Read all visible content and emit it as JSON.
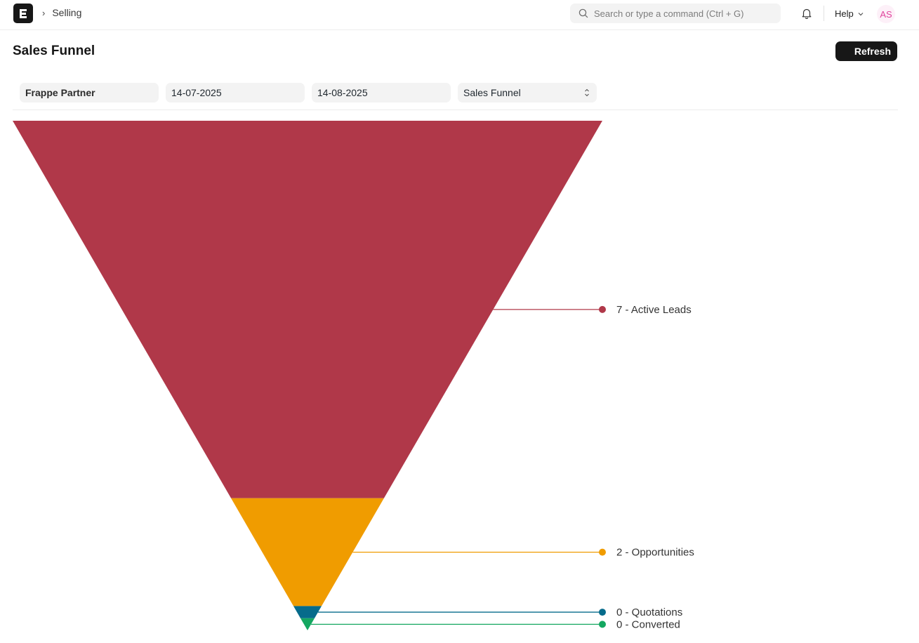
{
  "navbar": {
    "breadcrumb": "Selling",
    "search_placeholder": "Search or type a command (Ctrl + G)",
    "help_label": "Help",
    "avatar_initials": "AS"
  },
  "page": {
    "title": "Sales Funnel",
    "refresh_label": "Refresh"
  },
  "filters": {
    "company": "Frappe Partner",
    "from_date": "14-07-2025",
    "to_date": "14-08-2025",
    "report_type": "Sales Funnel"
  },
  "chart_data": {
    "type": "funnel",
    "stages": [
      {
        "label": "7 - Active Leads",
        "value": 7,
        "color": "#b03849"
      },
      {
        "label": "2 - Opportunities",
        "value": 2,
        "color": "#f09c00"
      },
      {
        "label": "0 - Quotations",
        "value": 0,
        "color": "#066b8b"
      },
      {
        "label": "0 - Converted",
        "value": 0,
        "color": "#14a760"
      }
    ]
  }
}
